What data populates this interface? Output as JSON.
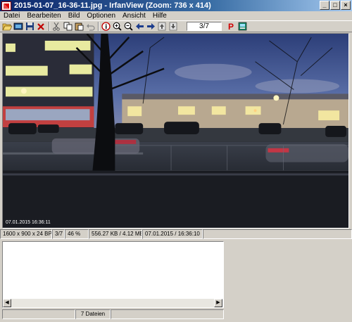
{
  "window": {
    "title": "2015-01-07_16-36-11.jpg - IrfanView (Zoom: 736 x 414)",
    "buttons": {
      "minimize": "_",
      "maximize": "□",
      "close": "×"
    }
  },
  "menu": [
    "Datei",
    "Bearbeiten",
    "Bild",
    "Optionen",
    "Ansicht",
    "Hilfe"
  ],
  "toolbar": {
    "page_field": "3/7",
    "icons": [
      "open-icon",
      "slideshow-icon",
      "save-icon",
      "delete-icon",
      "cut-icon",
      "copy-icon",
      "paste-icon",
      "undo-icon",
      "info-icon",
      "zoom-in-icon",
      "zoom-out-icon",
      "prev-icon",
      "next-icon",
      "upload-icon",
      "download-icon",
      "print-icon",
      "thumbnails-icon"
    ]
  },
  "image": {
    "stamp": "07.01.2015 16:36:11"
  },
  "status": {
    "dimensions": "1600 x 900 x 24 BPP",
    "index": "3/7",
    "zoom": "46 %",
    "size": "556.27 KB / 4.12 MB",
    "datetime": "07.01.2015 / 16:36:10"
  },
  "thumbs": {
    "file_count": "7 Dateien"
  },
  "colors": {
    "title_start": "#0a246a",
    "title_end": "#a6caf0",
    "window_bg": "#d4d0c8"
  }
}
